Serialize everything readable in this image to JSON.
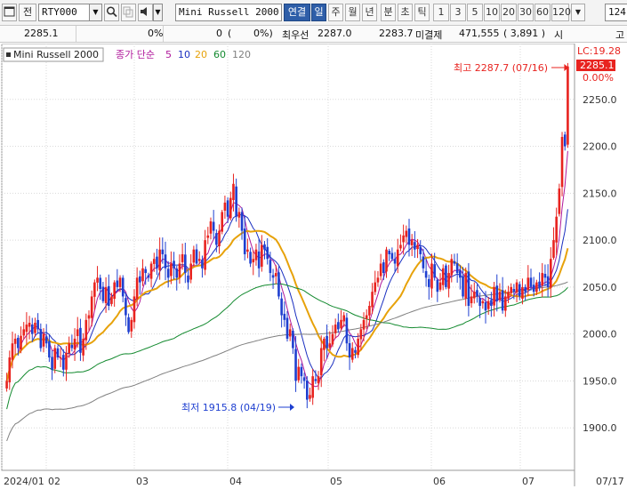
{
  "toolbar": {
    "window_icon": "window-icon",
    "jeon_label": "전",
    "symbol_code": "RTY000",
    "search_icon": "search-icon",
    "disabled_icon": "copy-icon",
    "speaker_icon": "speaker-icon",
    "symbol_name": "Mini Russell 2000",
    "link_label": "연결",
    "periods": [
      "일",
      "주",
      "월",
      "년",
      "분",
      "초",
      "틱"
    ],
    "active_period": "일",
    "intervals": [
      "1",
      "3",
      "5",
      "10",
      "20",
      "30",
      "60",
      "120"
    ],
    "count_value": "124",
    "right_label": "고"
  },
  "infobar": {
    "price": "2285.1",
    "change_pct": "0%",
    "volume_change": "0",
    "paren_open": "(",
    "volume_pct": "0%)",
    "best_ask_label": "최우선",
    "best_ask": "2287.0",
    "best_bid": "2283.7",
    "open_interest_label": "미결제",
    "open_interest": "471,555",
    "oi_change": "( 3,891 )",
    "trailing_label": "시"
  },
  "legend": {
    "symbol_name": "Mini Russell 2000",
    "indicator_label": "종가 단순",
    "ma_periods": [
      "5",
      "10",
      "20",
      "60",
      "120"
    ],
    "ma_colors": [
      "#b0199b",
      "#1a2fc0",
      "#e7a20a",
      "#138a2f",
      "#808080"
    ]
  },
  "price_panel": {
    "lc_label": "LC:19.28",
    "current_price": "2285.1",
    "current_pct": "0.00%"
  },
  "annotations": {
    "high_text": "최고 2287.7 (07/16)",
    "low_text": "최저 1915.8 (04/19)"
  },
  "colors": {
    "up": "#e8231f",
    "down": "#1e3fd0",
    "grid": "#d9d9d9",
    "ma5": "#b0199b",
    "ma10": "#1a2fc0",
    "ma20": "#e7a20a",
    "ma60": "#138a2f",
    "ma120": "#808080"
  },
  "chart_data": {
    "type": "candlestick",
    "title": "Mini Russell 2000",
    "ylim": [
      1850,
      2300
    ],
    "y_ticks": [
      "2250.0",
      "2200.0",
      "2150.0",
      "2100.0",
      "2050.0",
      "2000.0",
      "1950.0",
      "1900.0"
    ],
    "x_tick_labels": [
      "2024/01",
      "02",
      "03",
      "04",
      "05",
      "06",
      "07",
      "07/17"
    ],
    "candles_close": [
      1950,
      1975,
      1990,
      1995,
      1985,
      1998,
      2005,
      2010,
      2012,
      2000,
      2012,
      2005,
      1985,
      2000,
      1990,
      1975,
      1962,
      1985,
      1975,
      1975,
      1962,
      1980,
      1990,
      1985,
      1995,
      2005,
      1980,
      1995,
      2015,
      2020,
      2040,
      2055,
      2060,
      2048,
      2035,
      2050,
      2030,
      2040,
      2055,
      2050,
      2060,
      2040,
      2020,
      2002,
      2015,
      2040,
      2060,
      2055,
      2070,
      2065,
      2060,
      2075,
      2080,
      2070,
      2090,
      2085,
      2070,
      2060,
      2075,
      2070,
      2060,
      2075,
      2085,
      2065,
      2055,
      2075,
      2090,
      2075,
      2080,
      2070,
      2100,
      2105,
      2120,
      2110,
      2095,
      2110,
      2130,
      2140,
      2125,
      2145,
      2160,
      2125,
      2130,
      2110,
      2085,
      2090,
      2075,
      2080,
      2090,
      2070,
      2095,
      2090,
      2080,
      2065,
      2060,
      2065,
      2040,
      2020,
      2015,
      1995,
      2005,
      1985,
      1950,
      1965,
      1955,
      1950,
      1930,
      1935,
      1955,
      1950,
      1955,
      1985,
      1995,
      1985,
      1990,
      2000,
      2010,
      2005,
      2015,
      2020,
      1990,
      1975,
      1985,
      1980,
      1995,
      2005,
      2015,
      2020,
      2030,
      2045,
      2055,
      2060,
      2075,
      2065,
      2090,
      2085,
      2080,
      2075,
      2090,
      2095,
      2105,
      2110,
      2095,
      2100,
      2090,
      2095,
      2085,
      2070,
      2060,
      2050,
      2075,
      2060,
      2045,
      2055,
      2070,
      2050,
      2065,
      2080,
      2075,
      2065,
      2060,
      2040,
      2065,
      2030,
      2040,
      2045,
      2040,
      2030,
      2035,
      2025,
      2035,
      2030,
      2050,
      2035,
      2045,
      2025,
      2040,
      2045,
      2050,
      2045,
      2055,
      2040,
      2050,
      2045,
      2060,
      2050,
      2045,
      2055,
      2050,
      2065,
      2060,
      2050,
      2080,
      2100,
      2125,
      2155,
      2210,
      2200,
      2285.1
    ],
    "ma_periods": [
      5,
      10,
      20,
      60,
      120
    ],
    "high_point": {
      "value": 2287.7,
      "date": "07/16"
    },
    "low_point": {
      "value": 1915.8,
      "date": "04/19"
    }
  }
}
